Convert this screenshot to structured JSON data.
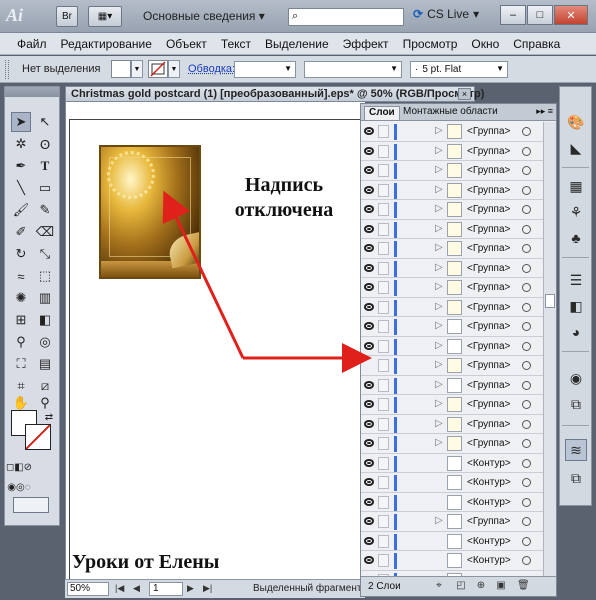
{
  "app": {
    "logo": "Ai",
    "bridge_label": "Br",
    "workspace": "Основные сведения",
    "cs_live": "CS Live"
  },
  "menu": [
    "Файл",
    "Редактирование",
    "Объект",
    "Текст",
    "Выделение",
    "Эффект",
    "Просмотр",
    "Окно",
    "Справка"
  ],
  "control": {
    "selection": "Нет выделения",
    "stroke_link": "Обводка:",
    "brush": "5 pt. Flat"
  },
  "document": {
    "title": "Christmas gold postcard (1) [преобразованный].eps* @ 50% (RGB/Просмотр)",
    "close": "×"
  },
  "canvas": {
    "annotation": "Надпись отключена",
    "caption": "Уроки от Елены"
  },
  "status": {
    "zoom": "50%",
    "page": "1",
    "text": "Выделенный фрагмент"
  },
  "layers_panel": {
    "tab_layers": "Слои",
    "tab_artboards": "Монтажные области",
    "footer_count": "2 Слои",
    "rows": [
      {
        "name": "<Группа>",
        "eye": true,
        "expand": true,
        "thumb": "gold"
      },
      {
        "name": "<Группа>",
        "eye": true,
        "expand": true,
        "thumb": "gold"
      },
      {
        "name": "<Группа>",
        "eye": true,
        "expand": true,
        "thumb": "gold"
      },
      {
        "name": "<Группа>",
        "eye": true,
        "expand": true,
        "thumb": "gold"
      },
      {
        "name": "<Группа>",
        "eye": true,
        "expand": true,
        "thumb": "gold"
      },
      {
        "name": "<Группа>",
        "eye": true,
        "expand": true,
        "thumb": "gold"
      },
      {
        "name": "<Группа>",
        "eye": true,
        "expand": true,
        "thumb": "gold"
      },
      {
        "name": "<Группа>",
        "eye": true,
        "expand": true,
        "thumb": "gold"
      },
      {
        "name": "<Группа>",
        "eye": true,
        "expand": true,
        "thumb": "gold"
      },
      {
        "name": "<Группа>",
        "eye": true,
        "expand": true,
        "thumb": "gold"
      },
      {
        "name": "<Группа>",
        "eye": true,
        "expand": true,
        "thumb": "plain"
      },
      {
        "name": "<Группа>",
        "eye": true,
        "expand": true,
        "thumb": "plain"
      },
      {
        "name": "<Группа>",
        "eye": false,
        "expand": true,
        "thumb": "gold"
      },
      {
        "name": "<Группа>",
        "eye": true,
        "expand": true,
        "thumb": "plain"
      },
      {
        "name": "<Группа>",
        "eye": true,
        "expand": true,
        "thumb": "gold"
      },
      {
        "name": "<Группа>",
        "eye": true,
        "expand": true,
        "thumb": "gold"
      },
      {
        "name": "<Группа>",
        "eye": true,
        "expand": true,
        "thumb": "gold"
      },
      {
        "name": "<Контур>",
        "eye": true,
        "expand": false,
        "thumb": "plain"
      },
      {
        "name": "<Контур>",
        "eye": true,
        "expand": false,
        "thumb": "plain"
      },
      {
        "name": "<Контур>",
        "eye": true,
        "expand": false,
        "thumb": "plain"
      },
      {
        "name": "<Группа>",
        "eye": true,
        "expand": true,
        "thumb": "plain"
      },
      {
        "name": "<Контур>",
        "eye": true,
        "expand": false,
        "thumb": "plain"
      },
      {
        "name": "<Контур>",
        "eye": true,
        "expand": false,
        "thumb": "plain"
      },
      {
        "name": "<Контур>",
        "eye": true,
        "expand": false,
        "thumb": "plain"
      }
    ]
  },
  "colors": {
    "arrow": "#e0201a",
    "layer_color": "#3b6fe0"
  },
  "icons": {
    "tools": [
      "selection-arrow-icon",
      "direct-selection-icon",
      "magic-wand-icon",
      "lasso-icon",
      "pen-icon",
      "type-icon",
      "line-icon",
      "rectangle-icon",
      "paintbrush-icon",
      "pencil-icon",
      "blob-brush-icon",
      "eraser-icon",
      "rotate-icon",
      "scale-icon",
      "warp-icon",
      "free-transform-icon",
      "symbol-sprayer-icon",
      "graph-icon",
      "mesh-icon",
      "gradient-icon",
      "eyedropper-icon",
      "blend-icon",
      "live-paint-icon",
      "column-graph-icon",
      "artboard-icon",
      "slice-icon",
      "hand-icon",
      "zoom-icon"
    ],
    "dock": [
      "color-palette-icon",
      "gradient-panel-icon",
      "swatches-icon",
      "brushes-icon",
      "symbols-icon",
      "stroke-icon",
      "transparency-icon",
      "appearance-icon",
      "graphic-styles-icon",
      "layers-icon",
      "artboards-icon"
    ]
  }
}
